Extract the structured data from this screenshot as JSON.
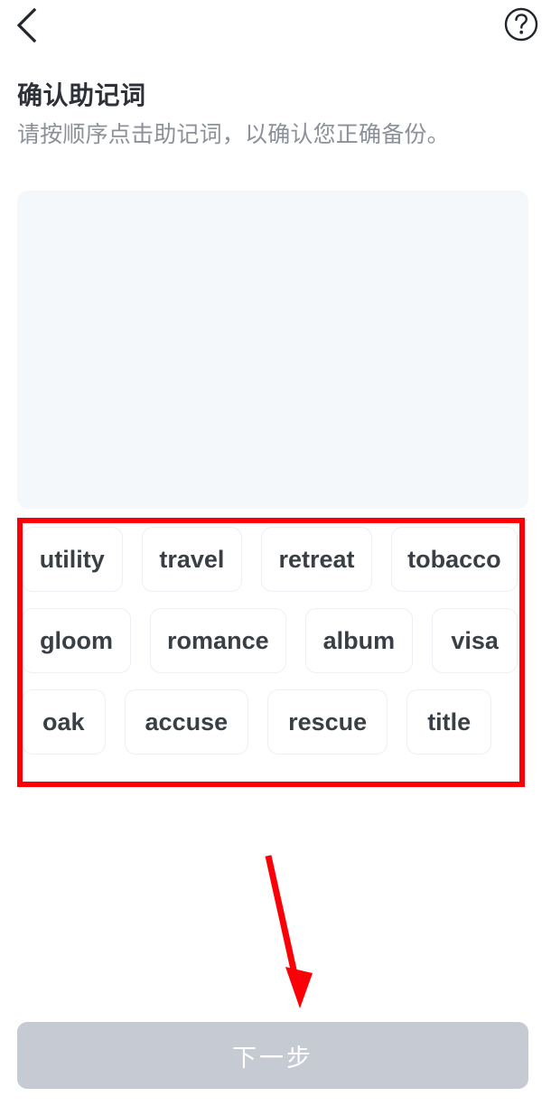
{
  "header": {
    "back_icon": "chevron-left-icon",
    "help_icon": "question-circle-icon"
  },
  "page_title": "确认助记词",
  "page_subtitle": "请按顺序点击助记词，以确认您正确备份。",
  "answer_panel": {
    "selected_words": [],
    "placeholder": ""
  },
  "word_bank": {
    "rows": [
      [
        "utility",
        "travel",
        "retreat",
        "tobacco"
      ],
      [
        "gloom",
        "romance",
        "album",
        "visa"
      ],
      [
        "oak",
        "accuse",
        "rescue",
        "title"
      ]
    ]
  },
  "footer": {
    "next_label": "下一步",
    "next_enabled": false
  },
  "annotations": {
    "highlight_color": "#fb0006",
    "arrow_color": "#fb0006"
  },
  "colors": {
    "title": "#2e3238",
    "subtitle": "#8b9099",
    "panel_bg": "#f5f8fb",
    "chip_bg": "#ffffff",
    "chip_border": "#eceff3",
    "chip_text": "#3a3f45",
    "button_disabled_bg": "#c6cad2",
    "button_text": "#ffffff"
  }
}
